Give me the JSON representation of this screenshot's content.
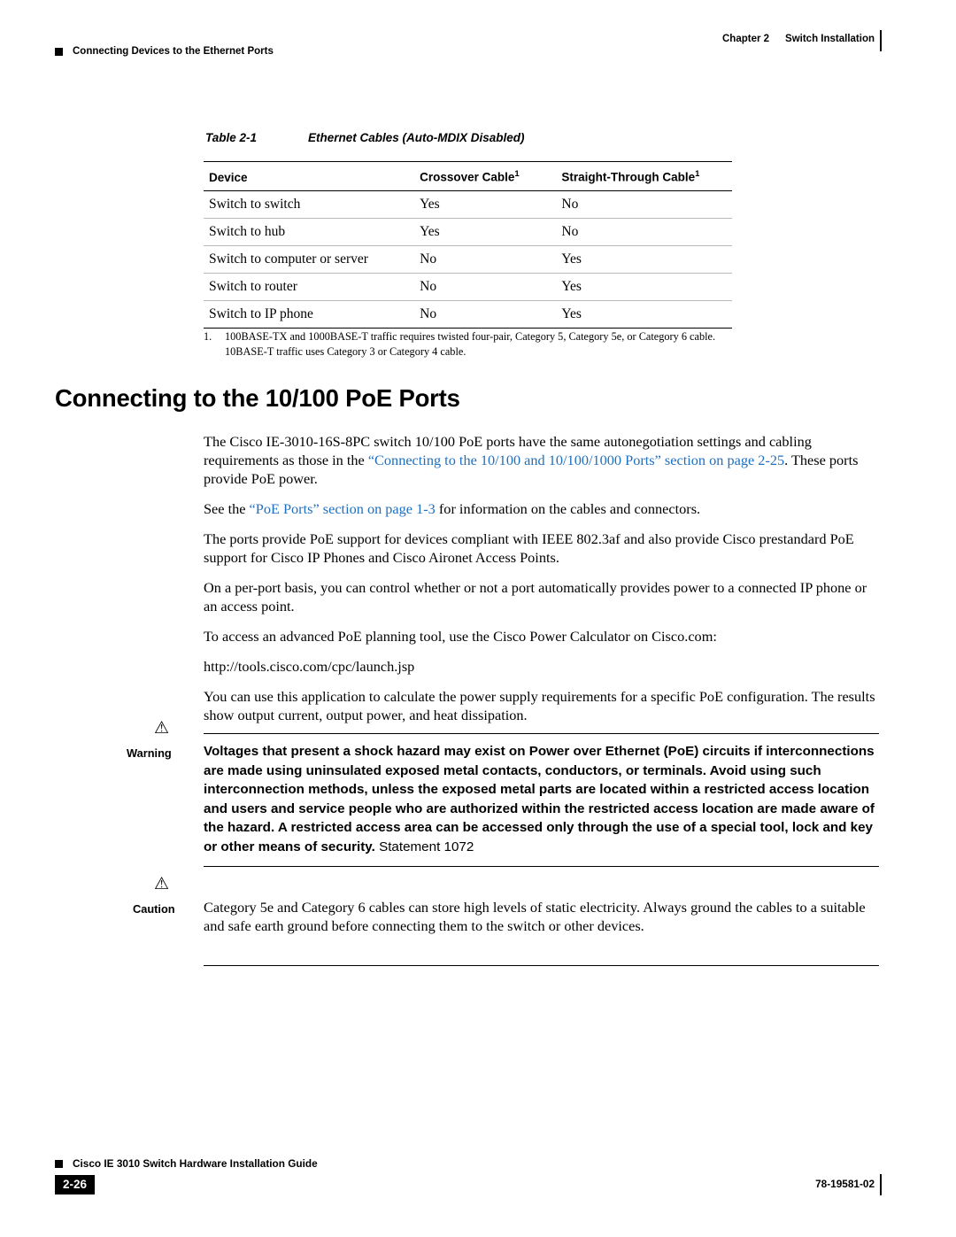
{
  "header": {
    "left_text": "Connecting Devices to the Ethernet Ports",
    "chapter": "Chapter 2",
    "chapter_title": "Switch Installation"
  },
  "table": {
    "caption_label": "Table 2-1",
    "caption_title": "Ethernet Cables (Auto-MDIX Disabled)",
    "columns": [
      "Device",
      "Crossover Cable",
      "Straight-Through Cable"
    ],
    "column_footnote_marker": "1",
    "rows": [
      {
        "device": "Switch to switch",
        "crossover": "Yes",
        "straight": "No"
      },
      {
        "device": "Switch to hub",
        "crossover": "Yes",
        "straight": "No"
      },
      {
        "device": "Switch to computer or server",
        "crossover": "No",
        "straight": "Yes"
      },
      {
        "device": "Switch to router",
        "crossover": "No",
        "straight": "Yes"
      },
      {
        "device": "Switch to IP phone",
        "crossover": "No",
        "straight": "Yes"
      }
    ],
    "footnote_number": "1.",
    "footnote_text": "100BASE-TX and 1000BASE-T traffic requires twisted four-pair, Category 5, Category 5e, or Category 6 cable. 10BASE-T traffic uses Category 3 or Category 4 cable."
  },
  "section": {
    "heading": "Connecting to the 10/100 PoE Ports",
    "para1_a": "The Cisco IE-3010-16S-8PC switch 10/100 PoE ports have the same autonegotiation settings and cabling requirements as those in the ",
    "para1_link": "“Connecting to the 10/100 and 10/100/1000 Ports” section on page 2-25",
    "para1_b": ". These ports provide PoE power.",
    "para2_a": "See the ",
    "para2_link": "“PoE Ports” section on page 1-3",
    "para2_b": " for information on the cables and connectors.",
    "para3": "The ports provide PoE support for devices compliant with IEEE 802.3af and also provide Cisco prestandard PoE support for Cisco IP Phones and Cisco Aironet Access Points.",
    "para4": "On a per-port basis, you can control whether or not a port automatically provides power to a connected IP phone or an access point.",
    "para5": "To access an advanced PoE planning tool, use the Cisco Power Calculator on Cisco.com:",
    "url": "http://tools.cisco.com/cpc/launch.jsp",
    "para6": "You can use this application to calculate the power supply requirements for a specific PoE configuration. The results show output current, output power, and heat dissipation."
  },
  "warning": {
    "label": "Warning",
    "icon": "⚠",
    "text": "Voltages that present a shock hazard may exist on Power over Ethernet (PoE) circuits if interconnections are made using uninsulated exposed metal contacts, conductors, or terminals. Avoid using such interconnection methods, unless the exposed metal parts are located within a restricted access location and users and service people who are authorized within the restricted access location are made aware of the hazard. A restricted access area can be accessed only through the use of a special tool, lock and key or other means of security.",
    "statement": " Statement 1072"
  },
  "caution": {
    "label": "Caution",
    "icon": "⚠",
    "text": "Category 5e and Category 6 cables can store high levels of static electricity. Always ground the cables to a suitable and safe earth ground before connecting them to the switch or other devices."
  },
  "footer": {
    "guide": "Cisco IE 3010 Switch Hardware Installation Guide",
    "page": "2-26",
    "doc_number": "78-19581-02"
  }
}
